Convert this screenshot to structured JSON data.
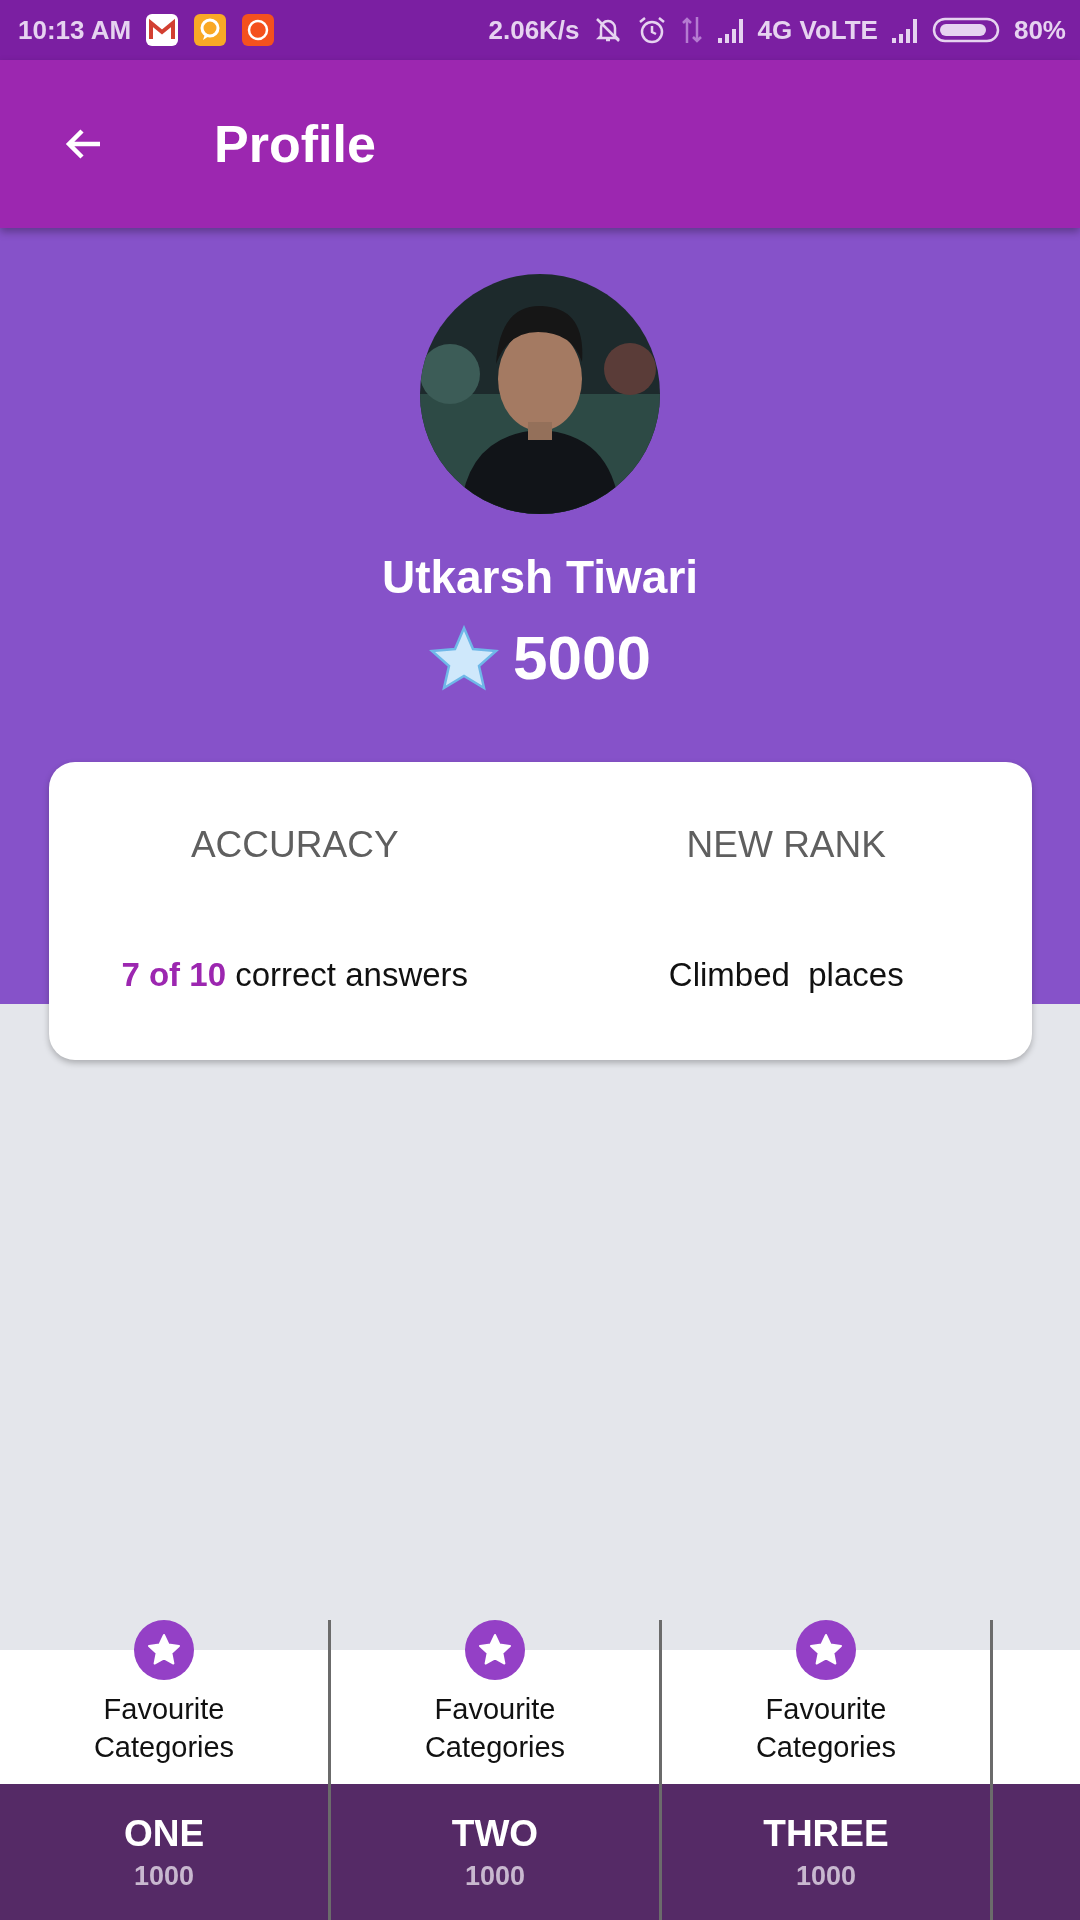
{
  "status_bar": {
    "time": "10:13 AM",
    "net_speed": "2.06K/s",
    "network": "4G VoLTE",
    "battery": "80%"
  },
  "app_bar": {
    "title": "Profile"
  },
  "profile": {
    "name": "Utkarsh Tiwari",
    "points": "5000"
  },
  "stats": [
    {
      "label": "ACCURACY",
      "value": "**7 of 10** correct answers"
    },
    {
      "label": "NEW RANK",
      "value": "Climbed  places"
    }
  ],
  "categories": [
    {
      "kind": "full",
      "label": "Favourite Categories",
      "name": "ONE",
      "score": "1000"
    },
    {
      "kind": "full",
      "label": "Favourite Categories",
      "name": "TWO",
      "score": "1000"
    },
    {
      "kind": "full",
      "label": "Favourite Categories",
      "name": "THREE",
      "score": "1000"
    },
    {
      "kind": "cut"
    }
  ]
}
